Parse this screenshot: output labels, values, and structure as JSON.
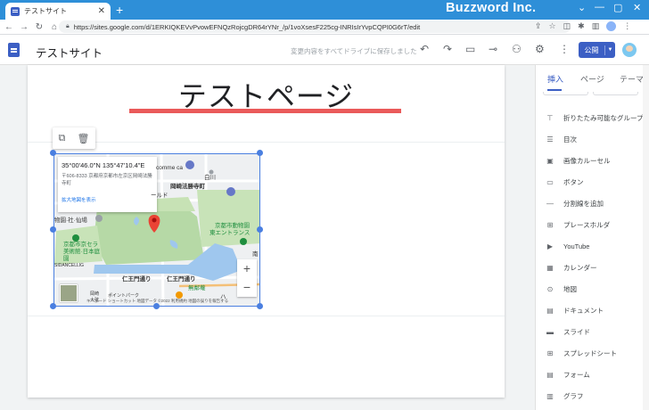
{
  "browser": {
    "tab_title": "テストサイト",
    "tab_close": "✕",
    "new_tab": "+",
    "brand": "Buzzword Inc.",
    "url": "https://sites.google.com/d/1ERKIQKEVvPvowEFNQzRojcgDR64rYNr_/p/1voXsesF225cg-INRIsIrYvpCQPI0G6rT/edit"
  },
  "header": {
    "site_name": "テストサイト",
    "save_note": "変更内容をすべてドライブに保存しました",
    "publish_label": "公開"
  },
  "page": {
    "title": "テストページ",
    "underline_color": "#ea5a5a"
  },
  "map": {
    "coords": "35°00'46.0\"N 135°47'10.4\"E",
    "address": "〒606-8333 京都府京都市左京区岡崎法勝寺町",
    "larger_map": "拡大地図を表示",
    "labels": {
      "okazaki": "岡崎法勝寺町",
      "zoo": "京都市動物園",
      "zoo_entrance": "東エントランス",
      "art_museum": "京都市京セラ美術館·日本庭園",
      "garden": "物園·社·仙場",
      "niomon1": "仁王門通り",
      "niomon2": "仁王門通り",
      "muteki": "無鄰菴",
      "comme": "comme ca",
      "shirakawa": "白川",
      "road": "ールド",
      "hagi": "ハ",
      "pointe": "ポイントパーク",
      "okazakimachi": "岡崎",
      "daisan": "大弦",
      "minami": "南",
      "tsunagu": "仁",
      "shop": "SIDANCELLIG"
    },
    "footer": "キーボード ショートカット   地図データ ©2022   利用規約   地図の誤りを報告する",
    "zoom_in": "+",
    "zoom_out": "−"
  },
  "panel": {
    "tabs": [
      "挿入",
      "ページ",
      "テーマ"
    ],
    "items": [
      {
        "icon": "collapsible-icon",
        "glyph": "⊤",
        "label": "折りたたみ可能なグループ"
      },
      {
        "icon": "toc-icon",
        "glyph": "☰",
        "label": "目次"
      },
      {
        "icon": "carousel-icon",
        "glyph": "▣",
        "label": "画像カルーセル"
      },
      {
        "icon": "button-icon",
        "glyph": "▭",
        "label": "ボタン"
      },
      {
        "icon": "divider-icon",
        "glyph": "—",
        "label": "分割線を追加"
      },
      {
        "icon": "placeholder-icon",
        "glyph": "⊞",
        "label": "プレースホルダ"
      },
      {
        "icon": "youtube-icon",
        "glyph": "▶",
        "label": "YouTube"
      },
      {
        "icon": "calendar-icon",
        "glyph": "▦",
        "label": "カレンダー"
      },
      {
        "icon": "map-icon",
        "glyph": "⊙",
        "label": "地図"
      },
      {
        "icon": "docs-icon",
        "glyph": "▤",
        "label": "ドキュメント"
      },
      {
        "icon": "slides-icon",
        "glyph": "▬",
        "label": "スライド"
      },
      {
        "icon": "sheets-icon",
        "glyph": "⊞",
        "label": "スプレッドシート"
      },
      {
        "icon": "forms-icon",
        "glyph": "▤",
        "label": "フォーム"
      },
      {
        "icon": "charts-icon",
        "glyph": "▥",
        "label": "グラフ"
      }
    ]
  }
}
